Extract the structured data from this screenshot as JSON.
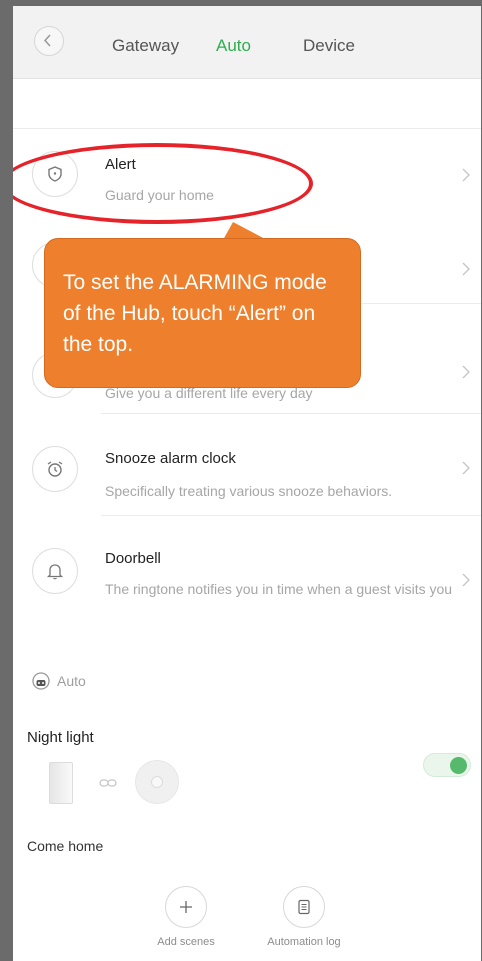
{
  "header": {
    "tabs": [
      {
        "label": "Gateway",
        "active": false
      },
      {
        "label": "Auto",
        "active": true
      },
      {
        "label": "Device",
        "active": false
      }
    ]
  },
  "scenes": [
    {
      "title": "Alert",
      "subtitle": "Guard your home",
      "icon": "shield-icon"
    },
    {
      "title": "",
      "subtitle": "",
      "icon": "hidden-icon"
    },
    {
      "title": "",
      "subtitle": "Give you a different life every day",
      "icon": "hidden-icon"
    },
    {
      "title": "Snooze alarm clock",
      "subtitle": "Specifically treating various snooze behaviors.",
      "icon": "alarm-clock-icon"
    },
    {
      "title": "Doorbell",
      "subtitle": "The ringtone notifies you in time when a guest visits you",
      "icon": "bell-icon"
    }
  ],
  "auto_section": {
    "label": "Auto"
  },
  "automations": [
    {
      "title": "Night light",
      "enabled": true
    },
    {
      "title": "Come home"
    }
  ],
  "bottom_actions": {
    "add_label": "Add scenes",
    "log_label": "Automation log"
  },
  "callout": {
    "text": "To set the ALARMING mode of the Hub, touch “Alert” on the top."
  },
  "colors": {
    "accent": "#2fae4f",
    "callout": "#ee7f2d",
    "highlight": "#e5232a"
  }
}
